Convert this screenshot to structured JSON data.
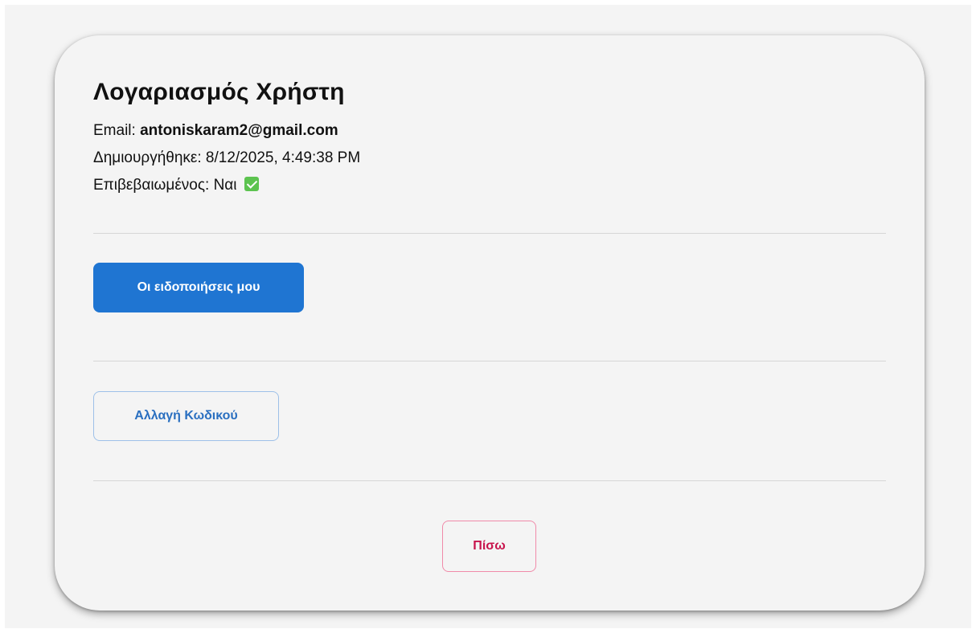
{
  "account": {
    "title": "Λογαριασμός Χρήστη",
    "email_label": "Email: ",
    "email_value": "antoniskaram2@gmail.com",
    "created_label": "Δημιουργήθηκε: ",
    "created_value": "8/12/2025, 4:49:38 PM",
    "verified_label": "Επιβεβαιωμένος: ",
    "verified_value": "Ναι",
    "verified_icon": "check-icon"
  },
  "actions": {
    "notifications_label": "Οι ειδοποιήσεις μου",
    "change_password_label": "Αλλαγή Κωδικού",
    "back_label": "Πίσω"
  },
  "colors": {
    "primary": "#1f75d2",
    "secondary_text": "#2a6fc0",
    "danger_text": "#c8144c",
    "check_green": "#5cc34f"
  }
}
